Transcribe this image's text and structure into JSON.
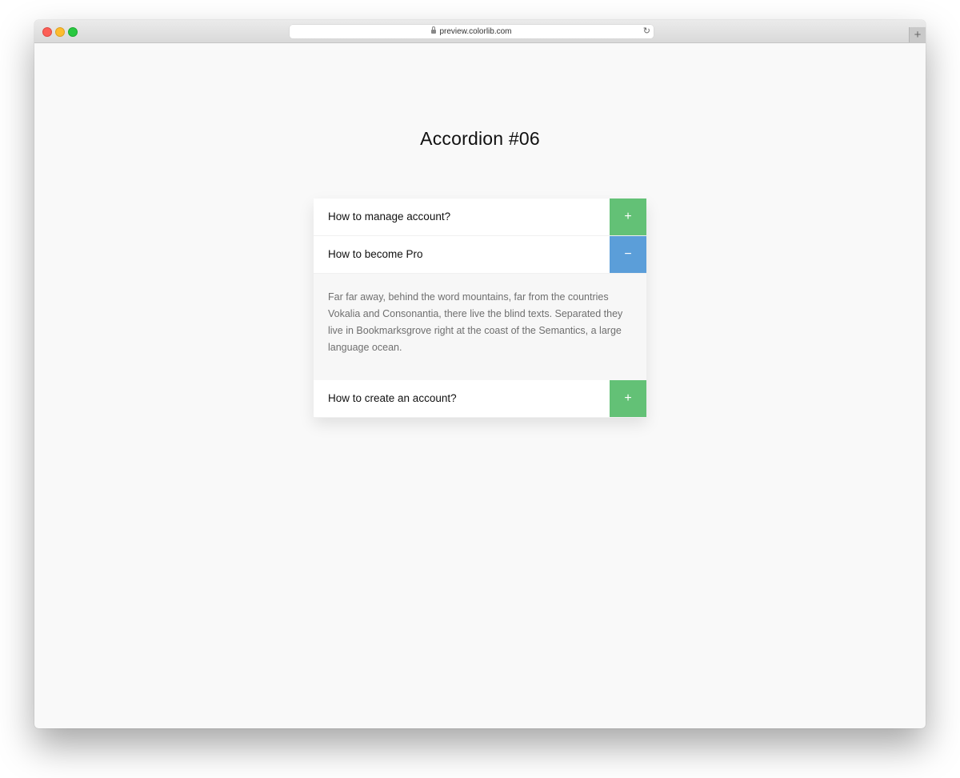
{
  "browser": {
    "url": "preview.colorlib.com",
    "lock_icon": "lock-icon",
    "reload_icon": "reload-icon",
    "newtab_label": "+"
  },
  "page": {
    "title": "Accordion #06"
  },
  "colors": {
    "collapsed_toggle": "#63c176",
    "expanded_toggle": "#5b9ed9"
  },
  "accordion": {
    "items": [
      {
        "question": "How to manage account?",
        "toggle": "+",
        "expanded": false
      },
      {
        "question": "How to become Pro",
        "toggle": "−",
        "expanded": true,
        "answer": "Far far away, behind the word mountains, far from the countries Vokalia and Consonantia, there live the blind texts. Separated they live in Bookmarksgrove right at the coast of the Semantics, a large language ocean."
      },
      {
        "question": "How to create an account?",
        "toggle": "+",
        "expanded": false
      }
    ]
  }
}
